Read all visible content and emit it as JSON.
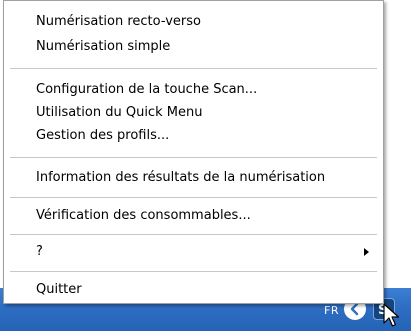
{
  "menu": {
    "items": [
      {
        "label": "Numérisation recto-verso"
      },
      {
        "label": "Numérisation simple"
      },
      {
        "label": "Configuration de la touche Scan..."
      },
      {
        "label": "Utilisation du Quick Menu"
      },
      {
        "label": "Gestion des profils..."
      },
      {
        "label": "Information des résultats de la numérisation"
      },
      {
        "label": "Vérification des consommables..."
      },
      {
        "label": "?"
      },
      {
        "label": "Quitter"
      }
    ]
  },
  "taskbar": {
    "language": "FR",
    "tray_icons": [
      "back-arrow-icon",
      "scanner-app-icon"
    ],
    "color": "#2f6fc4"
  },
  "cursor": {
    "icon": "mouse-pointer-icon"
  }
}
